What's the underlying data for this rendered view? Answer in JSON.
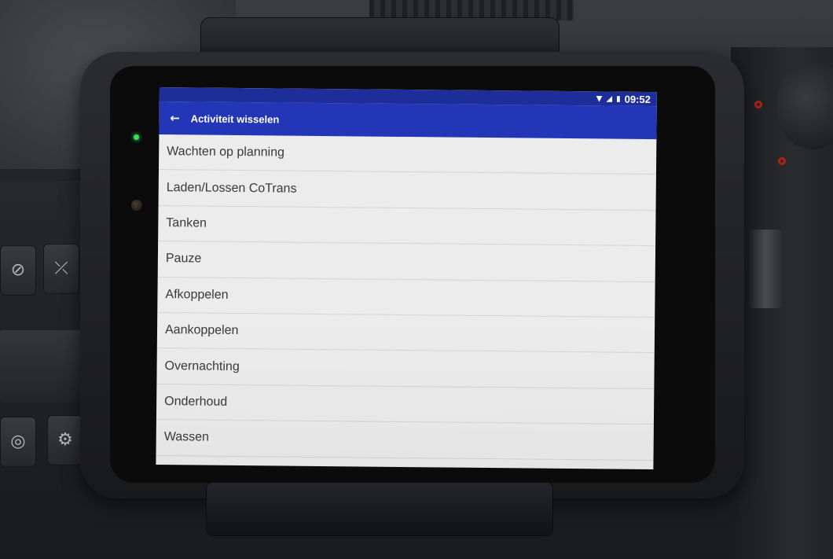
{
  "status_bar": {
    "time": "09:52",
    "icons": [
      "wifi-icon",
      "signal-icon",
      "battery-icon"
    ]
  },
  "app_bar": {
    "back_icon": "arrow-left-icon",
    "title": "Activiteit wisselen"
  },
  "activities": [
    {
      "label": "Wachten op planning"
    },
    {
      "label": "Laden/Lossen CoTrans"
    },
    {
      "label": "Tanken"
    },
    {
      "label": "Pauze"
    },
    {
      "label": "Afkoppelen"
    },
    {
      "label": "Aankoppelen"
    },
    {
      "label": "Overnachting"
    },
    {
      "label": "Onderhoud"
    },
    {
      "label": "Wassen"
    }
  ],
  "colors": {
    "app_bar": "#2336b8",
    "status_bar": "#1d2e9a",
    "list_background": "#ececec",
    "led": "#3fdc5a"
  }
}
